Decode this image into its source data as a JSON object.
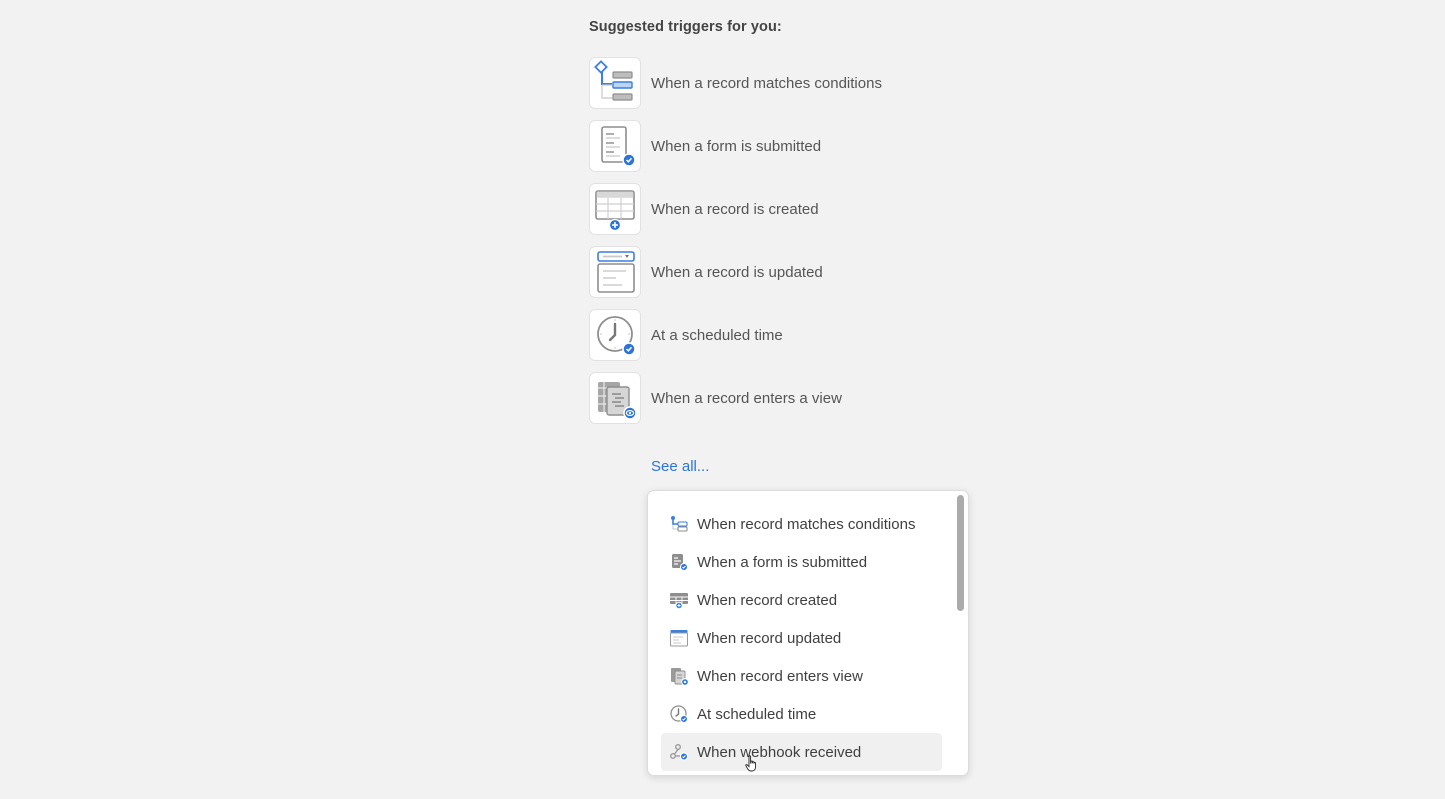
{
  "heading": "Suggested triggers for you:",
  "suggested_triggers": [
    {
      "label": "When a record matches conditions",
      "icon": "conditions-icon"
    },
    {
      "label": "When a form is submitted",
      "icon": "form-submitted-icon"
    },
    {
      "label": "When a record is created",
      "icon": "record-created-icon"
    },
    {
      "label": "When a record is updated",
      "icon": "record-updated-icon"
    },
    {
      "label": "At a scheduled time",
      "icon": "scheduled-time-icon"
    },
    {
      "label": "When a record enters a view",
      "icon": "record-enters-view-icon"
    }
  ],
  "see_all_label": "See all...",
  "dropdown": {
    "items": [
      {
        "label": "When record matches conditions",
        "icon": "conditions-icon"
      },
      {
        "label": "When a form is submitted",
        "icon": "form-submitted-icon"
      },
      {
        "label": "When record created",
        "icon": "record-created-icon"
      },
      {
        "label": "When record updated",
        "icon": "record-updated-icon"
      },
      {
        "label": "When record enters view",
        "icon": "record-enters-view-icon"
      },
      {
        "label": "At scheduled time",
        "icon": "scheduled-time-icon"
      },
      {
        "label": "When webhook received",
        "icon": "webhook-icon",
        "hovered": true
      }
    ]
  },
  "colors": {
    "accent": "#2d74d8",
    "background": "#f2f2f2",
    "icon_gray": "#8e8e8e"
  }
}
